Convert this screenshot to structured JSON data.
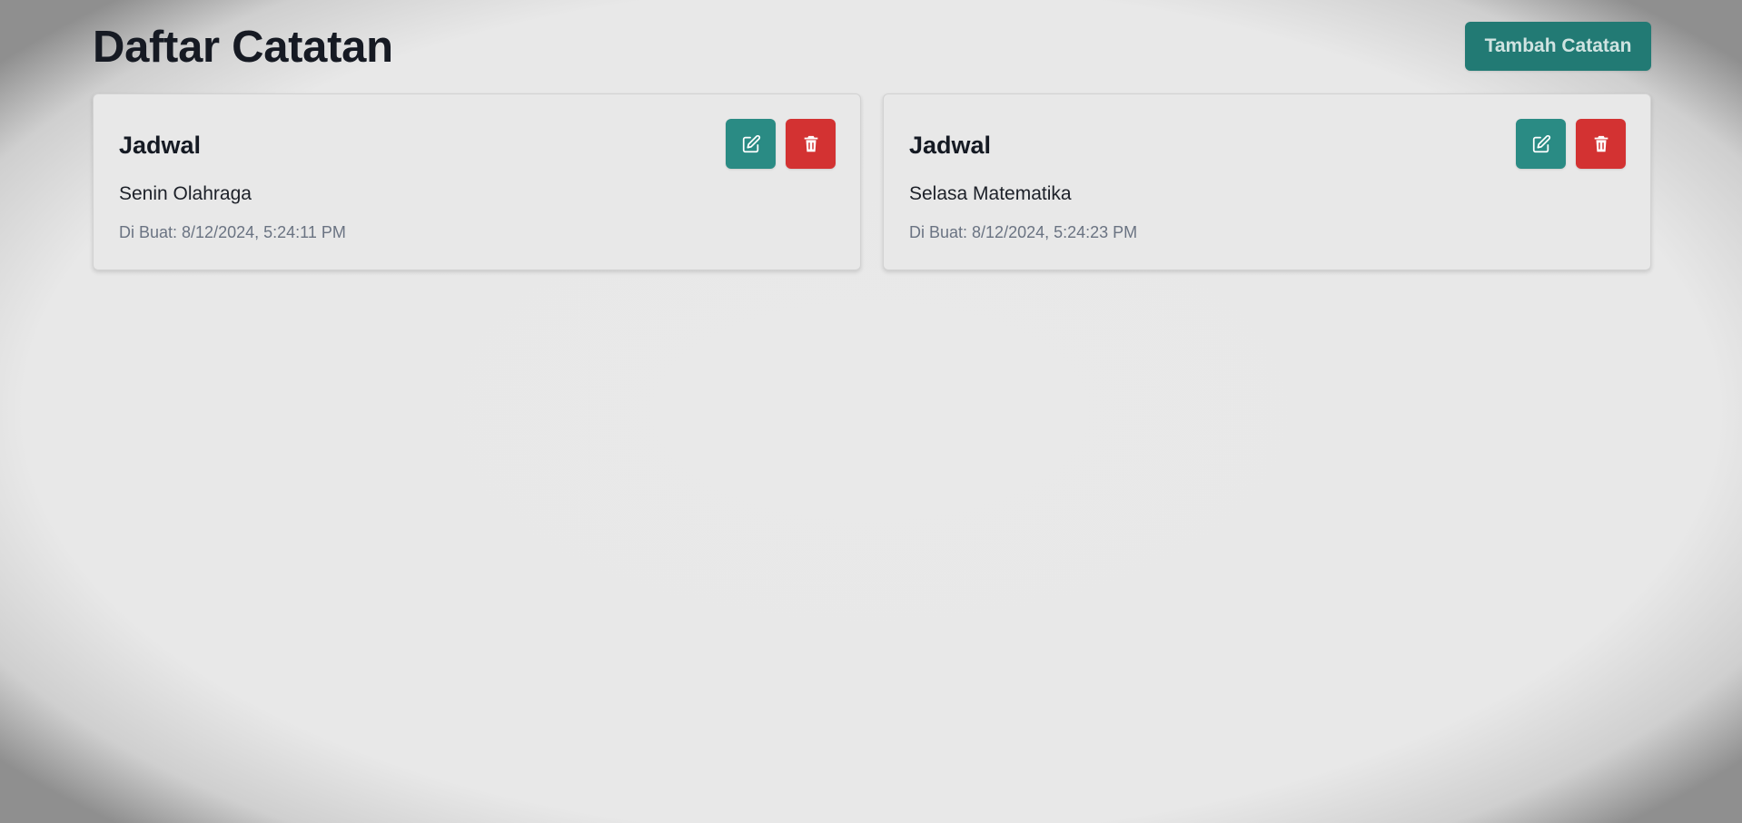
{
  "page": {
    "title": "Daftar Catatan",
    "add_button_label": "Tambah Catatan"
  },
  "notes": [
    {
      "title": "Jadwal",
      "content": "Senin Olahraga",
      "created": "Di Buat: 8/12/2024, 5:24:11 PM"
    },
    {
      "title": "Jadwal",
      "content": "Selasa Matematika",
      "created": "Di Buat: 8/12/2024, 5:24:23 PM"
    }
  ],
  "icons": {
    "edit": "edit-icon",
    "delete": "trash-icon"
  },
  "colors": {
    "primary": "#227a74",
    "edit": "#2a8b84",
    "danger": "#d33232",
    "title_text": "#161a23",
    "muted_text": "#6a7382"
  }
}
